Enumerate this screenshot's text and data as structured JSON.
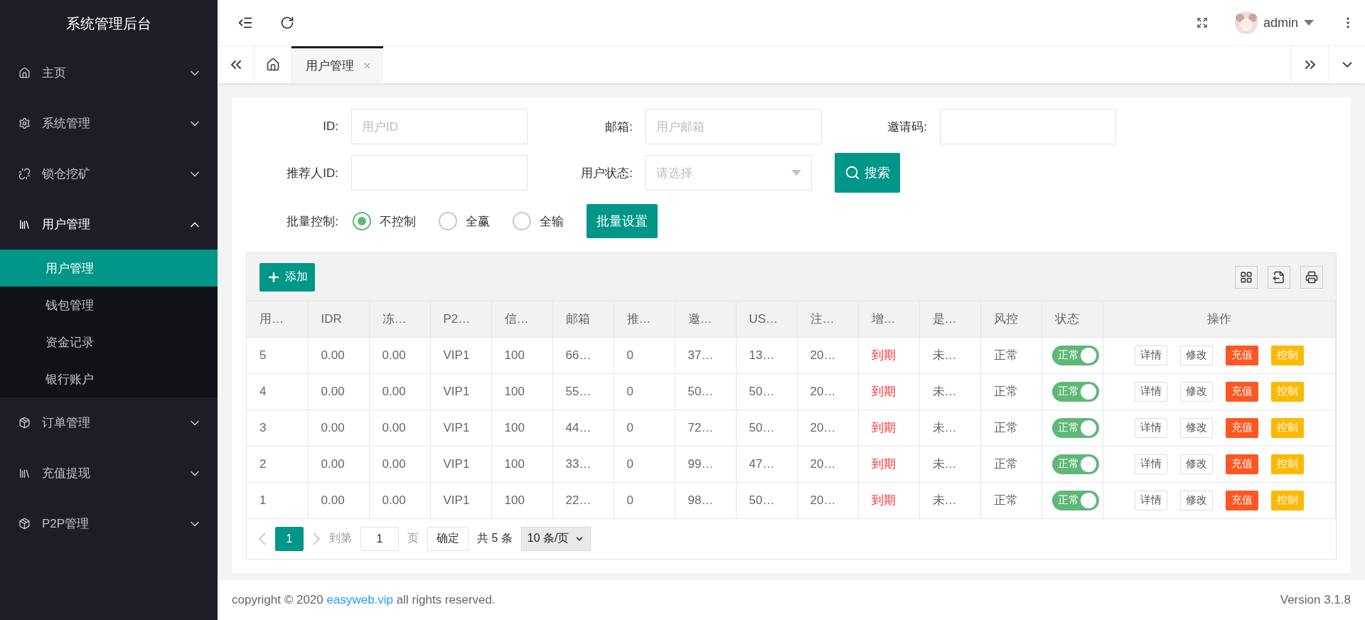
{
  "sidebar": {
    "title": "系统管理后台",
    "items": [
      {
        "label": "主页",
        "expanded": false
      },
      {
        "label": "系统管理",
        "expanded": false
      },
      {
        "label": "锁仓挖矿",
        "expanded": false
      },
      {
        "label": "用户管理",
        "expanded": true,
        "children": [
          {
            "label": "用户管理",
            "selected": true
          },
          {
            "label": "钱包管理",
            "selected": false
          },
          {
            "label": "资金记录",
            "selected": false
          },
          {
            "label": "银行账户",
            "selected": false
          }
        ]
      },
      {
        "label": "订单管理",
        "expanded": false
      },
      {
        "label": "充值提现",
        "expanded": false
      },
      {
        "label": "P2P管理",
        "expanded": false
      }
    ]
  },
  "header": {
    "user": "admin"
  },
  "tabs": [
    {
      "label": "用户管理",
      "selected": true
    }
  ],
  "filters": [
    {
      "label": "ID:",
      "kind": "text",
      "placeholder": "用户ID"
    },
    {
      "label": "邮箱:",
      "kind": "text",
      "placeholder": "用户邮箱"
    },
    {
      "label": "邀请码:",
      "kind": "text"
    },
    {
      "label": "推荐人ID:",
      "kind": "text"
    },
    {
      "label": "用户状态:",
      "kind": "select",
      "placeholder": "请选择"
    }
  ],
  "search_button": "搜索",
  "batch": {
    "label": "批量控制:",
    "options": [
      {
        "label": "不控制",
        "selected": true
      },
      {
        "label": "全赢",
        "selected": false
      },
      {
        "label": "全输",
        "selected": false
      }
    ],
    "button": "批量设置"
  },
  "table": {
    "add_button": "添加",
    "columns": [
      {
        "label": "用…",
        "accent": false
      },
      {
        "label": "IDR",
        "accent": false
      },
      {
        "label": "冻…",
        "accent": false
      },
      {
        "label": "P2…",
        "accent": false
      },
      {
        "label": "信…",
        "accent": false
      },
      {
        "label": "邮箱",
        "accent": false
      },
      {
        "label": "推…",
        "accent": false
      },
      {
        "label": "邀…",
        "accent": false
      },
      {
        "label": "US…",
        "accent": false
      },
      {
        "label": "注…",
        "accent": false
      },
      {
        "label": "增…",
        "accent": true
      },
      {
        "label": "是…",
        "accent": false
      },
      {
        "label": "风控",
        "accent": false
      }
    ],
    "status_column": "状态",
    "actions_column": "操作",
    "rows": [
      {
        "cells": [
          "5",
          "0.00",
          "0.00",
          "VIP1",
          "100",
          "66…",
          "0",
          "37…",
          "13…",
          "20…",
          "到期",
          "未…",
          "正常"
        ],
        "status": {
          "label": "正常",
          "on": true
        },
        "actions": [
          {
            "label": "详情",
            "kind": "plain"
          },
          {
            "label": "修改",
            "kind": "plain"
          },
          {
            "label": "充值",
            "kind": "danger"
          },
          {
            "label": "控制",
            "kind": "warn"
          }
        ]
      },
      {
        "cells": [
          "4",
          "0.00",
          "0.00",
          "VIP1",
          "100",
          "55…",
          "0",
          "50…",
          "50…",
          "20…",
          "到期",
          "未…",
          "正常"
        ],
        "status": {
          "label": "正常",
          "on": true
        },
        "actions": [
          {
            "label": "详情",
            "kind": "plain"
          },
          {
            "label": "修改",
            "kind": "plain"
          },
          {
            "label": "充值",
            "kind": "danger"
          },
          {
            "label": "控制",
            "kind": "warn"
          }
        ]
      },
      {
        "cells": [
          "3",
          "0.00",
          "0.00",
          "VIP1",
          "100",
          "44…",
          "0",
          "72…",
          "50…",
          "20…",
          "到期",
          "未…",
          "正常"
        ],
        "status": {
          "label": "正常",
          "on": true
        },
        "actions": [
          {
            "label": "详情",
            "kind": "plain"
          },
          {
            "label": "修改",
            "kind": "plain"
          },
          {
            "label": "充值",
            "kind": "danger"
          },
          {
            "label": "控制",
            "kind": "warn"
          }
        ]
      },
      {
        "cells": [
          "2",
          "0.00",
          "0.00",
          "VIP1",
          "100",
          "33…",
          "0",
          "99…",
          "47…",
          "20…",
          "到期",
          "未…",
          "正常"
        ],
        "status": {
          "label": "正常",
          "on": true
        },
        "actions": [
          {
            "label": "详情",
            "kind": "plain"
          },
          {
            "label": "修改",
            "kind": "plain"
          },
          {
            "label": "充值",
            "kind": "danger"
          },
          {
            "label": "控制",
            "kind": "warn"
          }
        ]
      },
      {
        "cells": [
          "1",
          "0.00",
          "0.00",
          "VIP1",
          "100",
          "22…",
          "0",
          "98…",
          "50…",
          "20…",
          "到期",
          "未…",
          "正常"
        ],
        "status": {
          "label": "正常",
          "on": true
        },
        "actions": [
          {
            "label": "详情",
            "kind": "plain"
          },
          {
            "label": "修改",
            "kind": "plain"
          },
          {
            "label": "充值",
            "kind": "danger"
          },
          {
            "label": "控制",
            "kind": "warn"
          }
        ]
      }
    ]
  },
  "pagination": {
    "pages": [
      {
        "label": "1",
        "selected": true
      }
    ],
    "goto_label": "到第",
    "goto_value": "1",
    "page_unit": "页",
    "confirm": "确定",
    "total": "共 5 条",
    "page_size": "10 条/页"
  },
  "footer": {
    "before": "copyright © 2020",
    "link": "easyweb.vip",
    "after": "all rights reserved.",
    "version": "Version 3.1.8"
  }
}
